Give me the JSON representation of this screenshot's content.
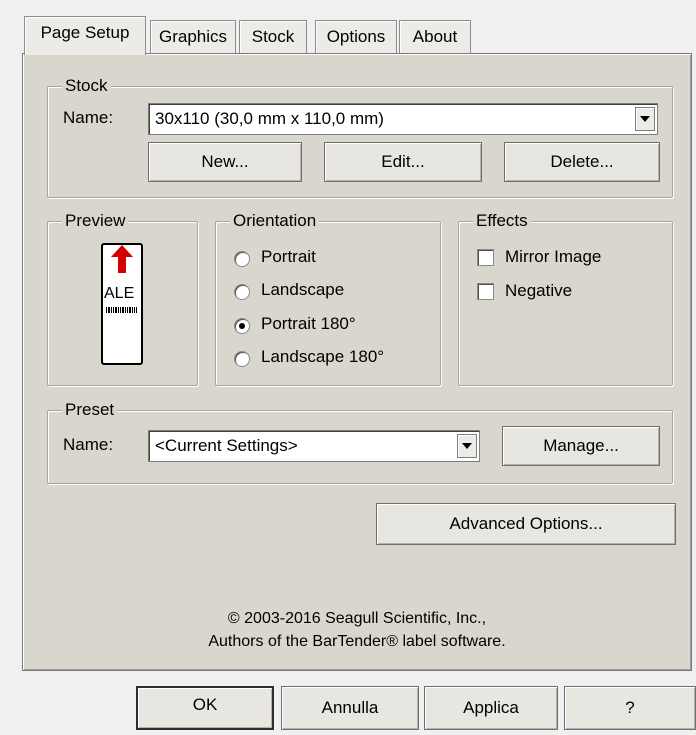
{
  "tabs": [
    {
      "label": "Page Setup",
      "active": true
    },
    {
      "label": "Graphics",
      "active": false
    },
    {
      "label": "Stock",
      "active": false
    },
    {
      "label": "Options",
      "active": false
    },
    {
      "label": "About",
      "active": false
    }
  ],
  "stock": {
    "title": "Stock",
    "name_label": "Name:",
    "name_value": "30x110 (30,0 mm x 110,0 mm)",
    "new_label": "New...",
    "edit_label": "Edit...",
    "delete_label": "Delete..."
  },
  "preview": {
    "title": "Preview",
    "label_text": "ALE"
  },
  "orientation": {
    "title": "Orientation",
    "options": [
      "Portrait",
      "Landscape",
      "Portrait 180°",
      "Landscape 180°"
    ],
    "selected": "Portrait 180°"
  },
  "effects": {
    "title": "Effects",
    "mirror_label": "Mirror Image",
    "mirror_checked": false,
    "negative_label": "Negative",
    "negative_checked": false
  },
  "preset": {
    "title": "Preset",
    "name_label": "Name:",
    "name_value": "<Current Settings>",
    "manage_label": "Manage..."
  },
  "advanced_label": "Advanced Options...",
  "copyright": {
    "line1": "© 2003-2016 Seagull Scientific, Inc.,",
    "line2": "Authors of the BarTender® label software."
  },
  "buttons": {
    "ok": "OK",
    "cancel": "Annulla",
    "apply": "Applica",
    "help": "?"
  },
  "colors": {
    "arrow": "#d40000",
    "panel": "#d9d6ce"
  }
}
